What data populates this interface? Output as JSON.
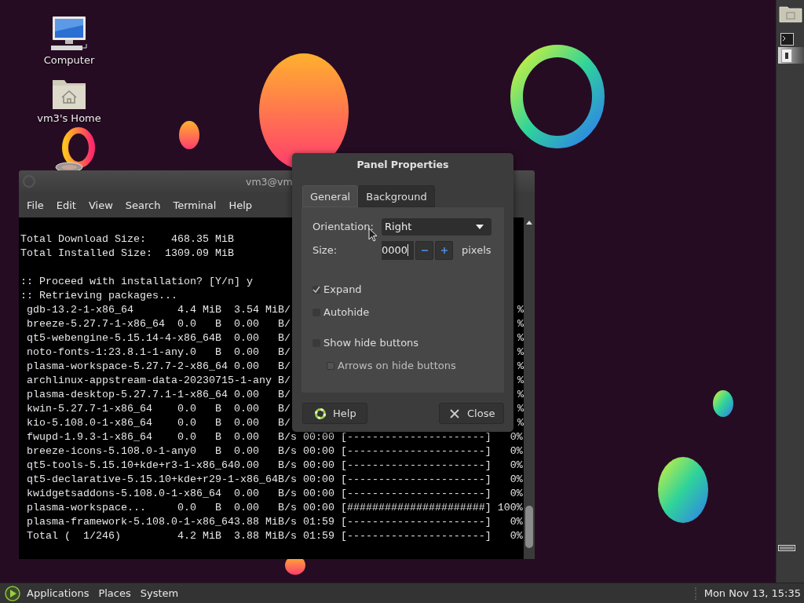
{
  "desktop": {
    "icons": [
      {
        "label": "Computer",
        "kind": "computer"
      },
      {
        "label": "vm3's Home",
        "kind": "home"
      }
    ]
  },
  "terminal": {
    "title": "vm3@vm",
    "menu": [
      "File",
      "Edit",
      "View",
      "Search",
      "Terminal",
      "Help"
    ],
    "lines": [
      {
        "text": "Total Download Size:    468.35 MiB"
      },
      {
        "text": "Total Installed Size:  1309.09 MiB"
      },
      {
        "text": ":: Proceed with installation? [Y/n] y",
        "blank_before": true
      },
      {
        "text": ":: Retrieving packages..."
      },
      {
        "text": " gdb-13.2-1-x86_64       4.4 MiB  3.54 MiB/",
        "tail": "%"
      },
      {
        "text": " breeze-5.27.7-1-x86_64  0.0   B  0.00   B/",
        "tail": "%"
      },
      {
        "text": " qt5-webengine-5.15.14-4-x86_64B  0.00   B/",
        "tail": "%"
      },
      {
        "text": " noto-fonts-1:23.8.1-1-any.0   B  0.00   B/",
        "tail": "%"
      },
      {
        "text": " plasma-workspace-5.27.7-2-x86_64 0.00   B/",
        "tail": "%"
      },
      {
        "text": " archlinux-appstream-data-20230715-1-any B/",
        "tail": "%"
      },
      {
        "text": " plasma-desktop-5.27.7.1-1-x86_64 0.00   B/",
        "tail": "%"
      },
      {
        "text": " kwin-5.27.7-1-x86_64    0.0   B  0.00   B/",
        "tail": "%"
      },
      {
        "text": " kio-5.108.0-1-x86_64    0.0   B  0.00   B/",
        "tail": "%"
      },
      {
        "text": " fwupd-1.9.3-1-x86_64    0.0   B  0.00   B/s 00:00 [----------------------]   0%"
      },
      {
        "text": " breeze-icons-5.108.0-1-any0   B  0.00   B/s 00:00 [----------------------]   0%"
      },
      {
        "text": " qt5-tools-5.15.10+kde+r3-1-x86_640.00   B/s 00:00 [----------------------]   0%"
      },
      {
        "text": " qt5-declarative-5.15.10+kde+r29-1-x86_64B/s 00:00 [----------------------]   0%"
      },
      {
        "text": " kwidgetsaddons-5.108.0-1-x86_64  0.00   B/s 00:00 [----------------------]   0%"
      },
      {
        "text": " plasma-workspace...     0.0   B  0.00   B/s 00:00 [######################] 100%"
      },
      {
        "text": " plasma-framework-5.108.0-1-x86_643.88 MiB/s 01:59 [----------------------]   0%"
      },
      {
        "text": " Total (  1/246)         4.2 MiB  3.88 MiB/s 01:59 [----------------------]   0%"
      }
    ]
  },
  "dialog": {
    "title": "Panel Properties",
    "tabs": [
      {
        "label": "General",
        "selected": true
      },
      {
        "label": "Background",
        "selected": false
      }
    ],
    "orientation": {
      "label": "Orientation:",
      "value": "Right"
    },
    "size": {
      "label": "Size:",
      "value": "0000",
      "unit": "pixels"
    },
    "checkboxes": [
      {
        "label": "Expand",
        "checked": true
      },
      {
        "label": "Autohide",
        "checked": false
      },
      {
        "label": "Show hide buttons",
        "checked": false,
        "children": [
          {
            "label": "Arrows on hide buttons",
            "checked": false,
            "disabled": true
          }
        ]
      }
    ],
    "buttons": [
      {
        "label": "Help",
        "kind": "help"
      },
      {
        "label": "Close",
        "kind": "close"
      }
    ]
  },
  "bottom_panel": {
    "menus": [
      "Applications",
      "Places",
      "System"
    ],
    "clock": "Mon Nov 13, 15:35"
  }
}
